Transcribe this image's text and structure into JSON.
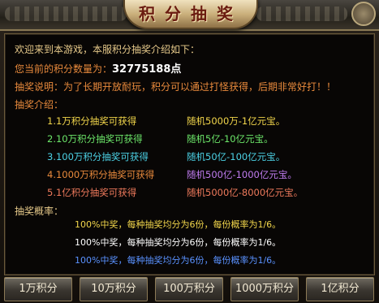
{
  "window": {
    "title": "积分抽奖"
  },
  "intro": {
    "welcome": "欢迎来到本游戏，本服积分抽奖介绍如下：",
    "points_label": "您当前的积分数量为：",
    "points_value": "32775188点",
    "description": "抽奖说明：为了长期开放耐玩，积分可以通过打怪获得，后期非常好打！！",
    "tiers_heading": "抽奖介绍："
  },
  "tiers": [
    {
      "name": "1.1万积分抽奖可获得",
      "reward": "随机5000万-1亿元宝。"
    },
    {
      "name": "2.10万积分抽奖可获得",
      "reward": "随机5亿-10亿元宝。"
    },
    {
      "name": "3.100万积分抽奖可获得",
      "reward": "随机50亿-100亿元宝。"
    },
    {
      "name": "4.1000万积分抽奖可获得",
      "reward": "随机500亿-1000亿元宝。"
    },
    {
      "name": "5.1亿积分抽奖可获得",
      "reward": "随机5000亿-8000亿元宝。"
    }
  ],
  "probability": {
    "heading": "抽奖概率：",
    "lines": [
      "100%中奖，每种抽奖均分为6份，每份概率为1/6。",
      "100%中奖，每种抽奖均分为6份，每份概率为1/6。",
      "100%中奖，每种抽奖均分为6份，每份概率为1/6。"
    ]
  },
  "buttons": [
    {
      "label": "1万积分"
    },
    {
      "label": "10万积分"
    },
    {
      "label": "100万积分"
    },
    {
      "label": "1000万积分"
    },
    {
      "label": "1亿积分"
    }
  ]
}
